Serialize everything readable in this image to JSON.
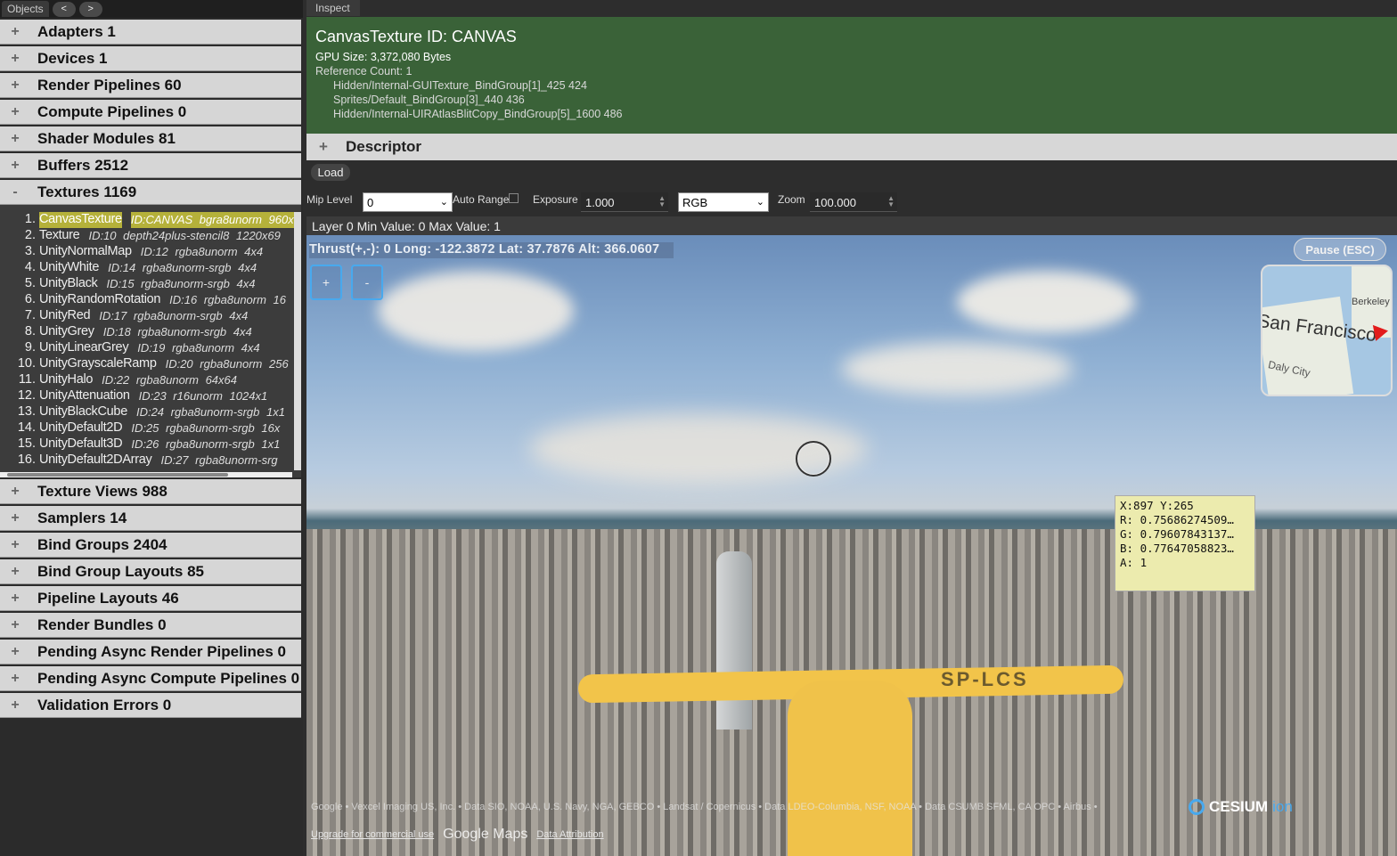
{
  "left_panel": {
    "tab_label": "Objects",
    "nav_prev": "<",
    "nav_next": ">",
    "categories_top": [
      {
        "sign": "+",
        "label": "Adapters 1"
      },
      {
        "sign": "+",
        "label": "Devices 1"
      },
      {
        "sign": "+",
        "label": "Render Pipelines 60"
      },
      {
        "sign": "+",
        "label": "Compute Pipelines 0"
      },
      {
        "sign": "+",
        "label": "Shader Modules 81"
      },
      {
        "sign": "+",
        "label": "Buffers 2512"
      },
      {
        "sign": "-",
        "label": "Textures 1169"
      }
    ],
    "textures": [
      {
        "num": "1.",
        "name": "CanvasTexture",
        "meta": "ID:CANVAS bgra8unorm 960x",
        "selected": true
      },
      {
        "num": "2.",
        "name": "Texture",
        "meta": "ID:10 depth24plus-stencil8 1220x69"
      },
      {
        "num": "3.",
        "name": "UnityNormalMap",
        "meta": "ID:12 rgba8unorm 4x4"
      },
      {
        "num": "4.",
        "name": "UnityWhite",
        "meta": "ID:14 rgba8unorm-srgb 4x4"
      },
      {
        "num": "5.",
        "name": "UnityBlack",
        "meta": "ID:15 rgba8unorm-srgb 4x4"
      },
      {
        "num": "6.",
        "name": "UnityRandomRotation",
        "meta": "ID:16 rgba8unorm 16"
      },
      {
        "num": "7.",
        "name": "UnityRed",
        "meta": "ID:17 rgba8unorm-srgb 4x4"
      },
      {
        "num": "8.",
        "name": "UnityGrey",
        "meta": "ID:18 rgba8unorm-srgb 4x4"
      },
      {
        "num": "9.",
        "name": "UnityLinearGrey",
        "meta": "ID:19 rgba8unorm 4x4"
      },
      {
        "num": "10.",
        "name": "UnityGrayscaleRamp",
        "meta": "ID:20 rgba8unorm 256"
      },
      {
        "num": "11.",
        "name": "UnityHalo",
        "meta": "ID:22 rgba8unorm 64x64"
      },
      {
        "num": "12.",
        "name": "UnityAttenuation",
        "meta": "ID:23 r16unorm 1024x1"
      },
      {
        "num": "13.",
        "name": "UnityBlackCube",
        "meta": "ID:24 rgba8unorm-srgb 1x1"
      },
      {
        "num": "14.",
        "name": "UnityDefault2D",
        "meta": "ID:25 rgba8unorm-srgb 16x"
      },
      {
        "num": "15.",
        "name": "UnityDefault3D",
        "meta": "ID:26 rgba8unorm-srgb 1x1"
      },
      {
        "num": "16.",
        "name": "UnityDefault2DArray",
        "meta": "ID:27 rgba8unorm-srg"
      }
    ],
    "categories_bottom": [
      {
        "sign": "+",
        "label": "Texture Views 988"
      },
      {
        "sign": "+",
        "label": "Samplers 14"
      },
      {
        "sign": "+",
        "label": "Bind Groups 2404"
      },
      {
        "sign": "+",
        "label": "Bind Group Layouts 85"
      },
      {
        "sign": "+",
        "label": "Pipeline Layouts 46"
      },
      {
        "sign": "+",
        "label": "Render Bundles 0"
      },
      {
        "sign": "+",
        "label": "Pending Async Render Pipelines 0"
      },
      {
        "sign": "+",
        "label": "Pending Async Compute Pipelines 0"
      },
      {
        "sign": "+",
        "label": "Validation Errors 0"
      }
    ]
  },
  "inspect": {
    "tab_label": "Inspect",
    "title": "CanvasTexture ID: CANVAS",
    "gpu_size": "GPU Size: 3,372,080 Bytes",
    "ref_count": "Reference Count: 1",
    "references": [
      "Hidden/Internal-GUITexture_BindGroup[1]_425 424",
      "Sprites/Default_BindGroup[3]_440 436",
      "Hidden/Internal-UIRAtlasBlitCopy_BindGroup[5]_1600 486"
    ],
    "descriptor_sign": "+",
    "descriptor_label": "Descriptor",
    "load_label": "Load"
  },
  "controls": {
    "mip_level_label": "Mip Level",
    "mip_level_value": "0",
    "auto_range_label": "Auto Range",
    "exposure_label": "Exposure",
    "exposure_value": "1.000",
    "channel_value": "RGB",
    "zoom_label": "Zoom",
    "zoom_value": "100.000"
  },
  "layer_info": "Layer 0 Min Value: 0 Max Value: 1",
  "viewport": {
    "hud": "Thrust(+,-): 0 Long: -122.3872 Lat: 37.7876 Alt: 366.0607",
    "zoom_in": "+",
    "zoom_out": "-",
    "pause_label": "Pause (ESC)",
    "minimap": {
      "city": "San Francisco",
      "north": "Berkeley",
      "south": "Daly City"
    },
    "plane_registration": "SP-LCS",
    "pixel_info": "X:897 Y:265\nR: 0.75686274509…\nG: 0.79607843137…\nB: 0.77647058823…\nA: 1",
    "attribution_line": "Google • Vexcel Imaging US, Inc. • Data SIO, NOAA, U.S. Navy, NGA, GEBCO • Landsat / Copernicus • Data LDEO-Columbia, NSF, NOAA • Data CSUMB SFML, CA OPC • Airbus •",
    "upgrade_link": "Upgrade for commercial use",
    "google_maps": "Google Maps",
    "data_attribution": "Data Attribution",
    "cesium_label": "CESIUM",
    "cesium_ion": "ion"
  }
}
